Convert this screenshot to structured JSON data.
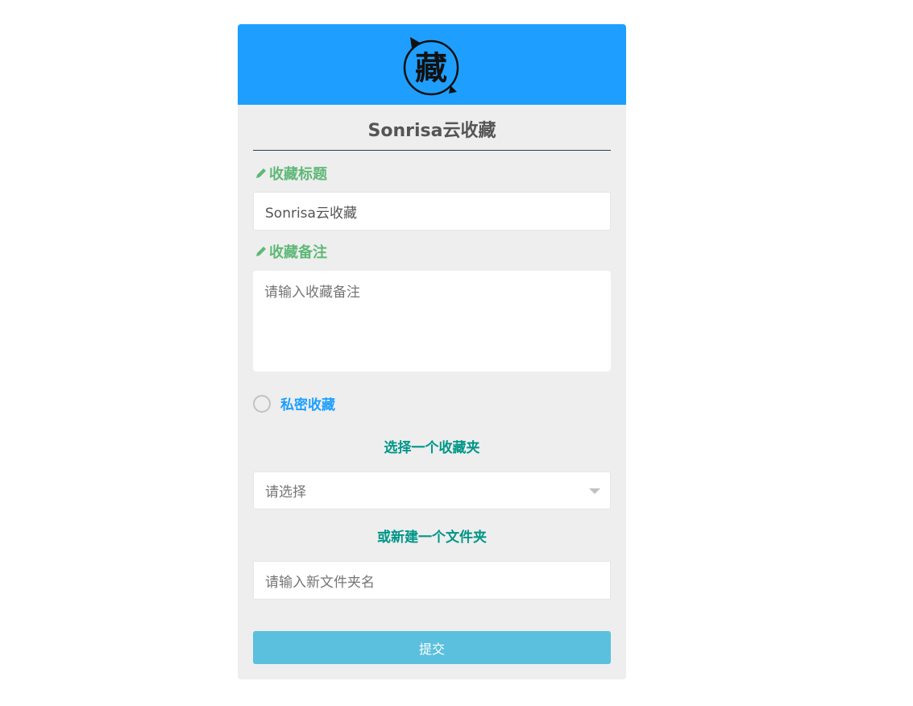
{
  "header": {
    "logo_char": "藏",
    "bg_color": "#1e9fff"
  },
  "title": "Sonrisa云收藏",
  "form": {
    "title_field": {
      "icon": "pencil-icon",
      "label": "收藏标题",
      "value": "Sonrisa云收藏"
    },
    "note_field": {
      "icon": "pencil-icon",
      "label": "收藏备注",
      "placeholder": "请输入收藏备注"
    },
    "private_toggle": {
      "label": "私密收藏",
      "checked": false
    },
    "folder_select": {
      "label": "选择一个收藏夹",
      "placeholder": "请选择",
      "icon": "caret-down-icon"
    },
    "new_folder": {
      "label": "或新建一个文件夹",
      "placeholder": "请输入新文件夹名"
    },
    "submit_label": "提交"
  },
  "colors": {
    "accent_blue": "#1e9fff",
    "label_green": "#5fb878",
    "section_teal": "#009688",
    "submit_bg": "#5bc0de"
  }
}
